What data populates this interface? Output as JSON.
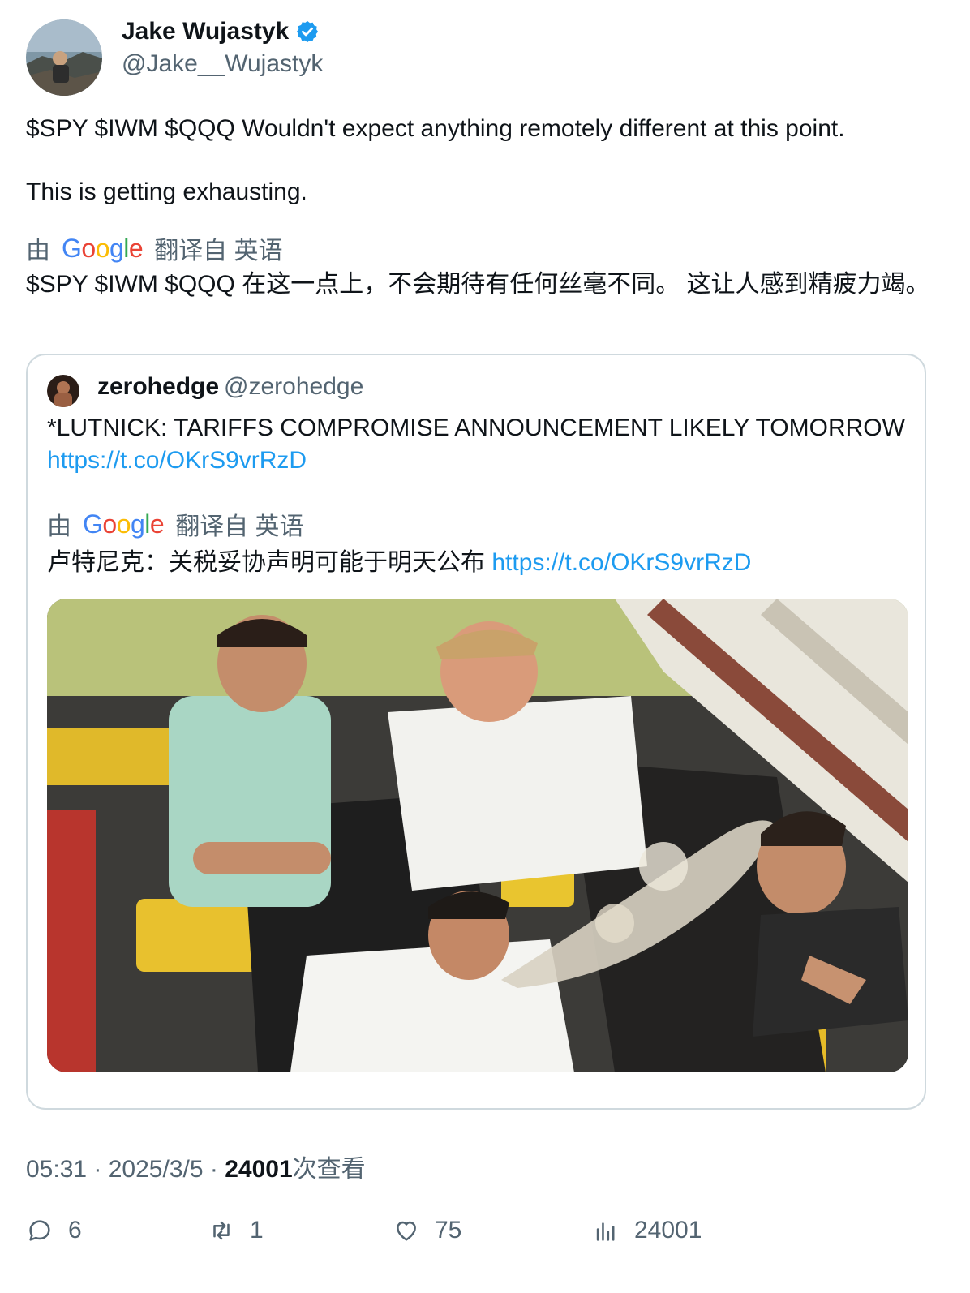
{
  "author": {
    "name": "Jake Wujastyk",
    "handle": "@Jake__Wujastyk",
    "verified_icon": "verified-badge-icon",
    "badge_color": "#1d9bf0"
  },
  "tweet": {
    "text_line1": "$SPY $IWM $QQQ Wouldn't expect anything remotely different at this point.",
    "text_line2": "This is getting exhausting.",
    "translate_prefix": "由",
    "translate_suffix": "翻译自 英语",
    "translated_text": "$SPY $IWM $QQQ 在这一点上，不会期待有任何丝毫不同。 这让人感到精疲力竭。"
  },
  "quote": {
    "name": "zerohedge",
    "handle": "@zerohedge",
    "text": "*LUTNICK: TARIFFS COMPROMISE ANNOUNCEMENT LIKELY TOMORROW",
    "link": "https://t.co/OKrS9vrRzD",
    "translate_prefix": "由",
    "translate_suffix": "翻译自 英语",
    "translated_text": "卢特尼克：关税妥协声明可能于明天公布",
    "translated_link": "https://t.co/OKrS9vrRzD"
  },
  "meta": {
    "time": "05:31",
    "date": "2025/3/5",
    "views": "24001",
    "views_suffix": "次查看",
    "separator": " · "
  },
  "actions": {
    "replies": "6",
    "retweets": "1",
    "likes": "75",
    "views": "24001"
  },
  "colors": {
    "text": "#0f1419",
    "secondary": "#536471",
    "link": "#1d9bf0",
    "border": "#cfd9de"
  }
}
